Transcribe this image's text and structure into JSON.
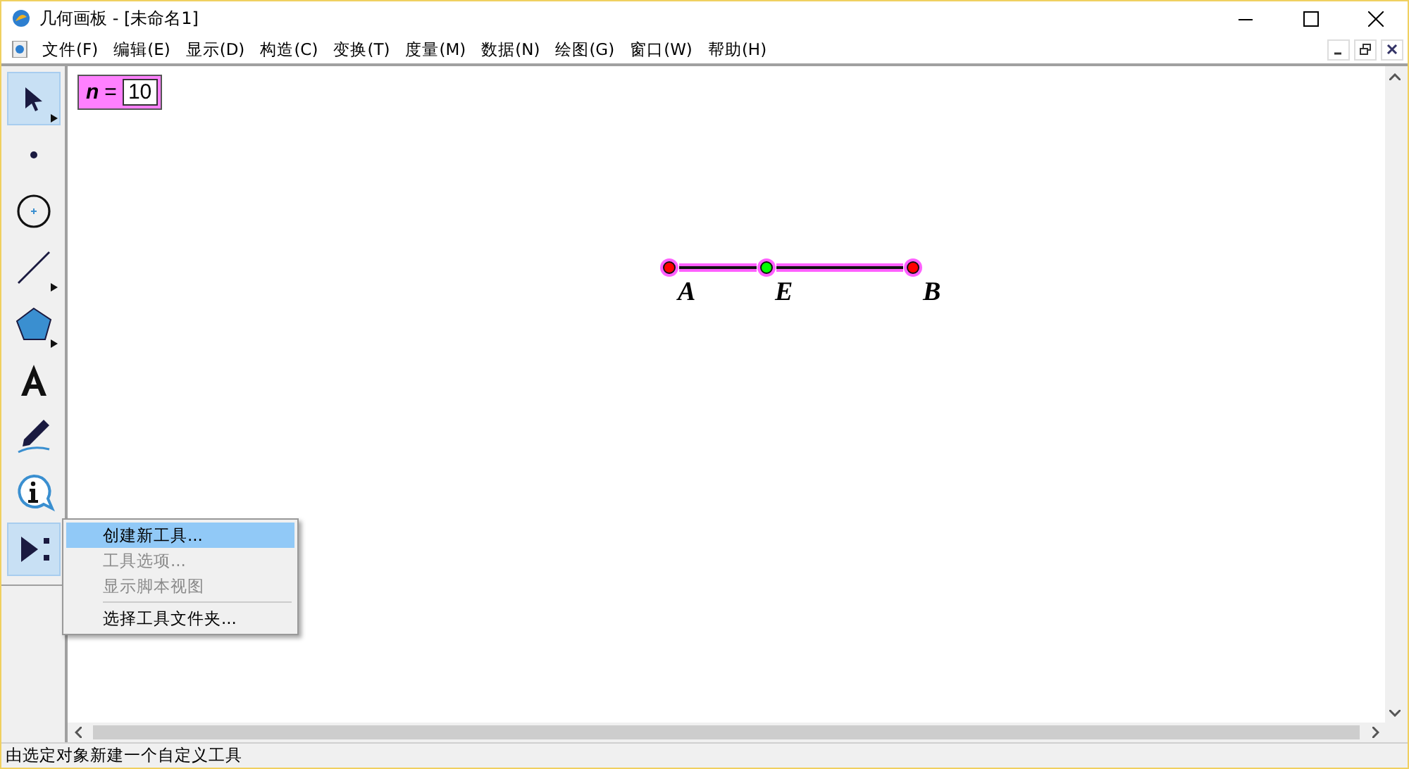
{
  "window": {
    "title": "几何画板 - [未命名1]"
  },
  "menu_bar": [
    "文件(F)",
    "编辑(E)",
    "显示(D)",
    "构造(C)",
    "变换(T)",
    "度量(M)",
    "数据(N)",
    "绘图(G)",
    "窗口(W)",
    "帮助(H)"
  ],
  "toolbox": [
    {
      "kind": "select",
      "selected": true,
      "submenu": true
    },
    {
      "kind": "point",
      "selected": false,
      "submenu": false
    },
    {
      "kind": "compass",
      "selected": false,
      "submenu": false
    },
    {
      "kind": "line",
      "selected": false,
      "submenu": true
    },
    {
      "kind": "polygon",
      "selected": false,
      "submenu": true
    },
    {
      "kind": "text",
      "selected": false,
      "submenu": false
    },
    {
      "kind": "marker",
      "selected": false,
      "submenu": false
    },
    {
      "kind": "info",
      "selected": false,
      "submenu": false
    },
    {
      "kind": "custom",
      "selected": true,
      "submenu": false
    }
  ],
  "parameter": {
    "name": "n",
    "equals": "=",
    "value": "10",
    "selected": true
  },
  "segment": {
    "selected": true
  },
  "points": [
    {
      "label": "A",
      "color": "#ff0000",
      "selected": true
    },
    {
      "label": "E",
      "color": "#00ff00",
      "selected": true
    },
    {
      "label": "B",
      "color": "#ff0000",
      "selected": true
    }
  ],
  "context_menu": [
    {
      "label": "创建新工具...",
      "selected": true,
      "disabled": false
    },
    {
      "label": "工具选项...",
      "selected": false,
      "disabled": true
    },
    {
      "label": "显示脚本视图",
      "selected": false,
      "disabled": true
    },
    {
      "label": "选择工具文件夹...",
      "selected": false,
      "disabled": false,
      "separator_before": true
    }
  ],
  "status_bar": "由选定对象新建一个自定义工具"
}
